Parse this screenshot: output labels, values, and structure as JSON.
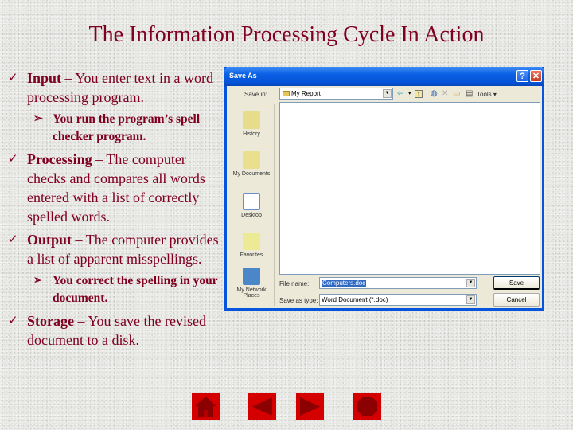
{
  "slide": {
    "title": "The Information Processing Cycle In Action",
    "bullets": [
      {
        "term": "Input",
        "text": " – You enter text in a word processing program.",
        "sub": "You run the program’s spell checker program."
      },
      {
        "term": "Processing",
        "text": " – The computer checks and compares all words entered with a list of correctly spelled words."
      },
      {
        "term": "Output",
        "text": " – The computer provides a list of apparent misspellings.",
        "sub": "You correct the spelling in your document."
      },
      {
        "term": "Storage",
        "text": " – You save the revised document to a disk."
      }
    ],
    "check_glyph": "✓",
    "arrow_glyph": "➢"
  },
  "dialog": {
    "title": "Save As",
    "help_label": "?",
    "close_label": "✕",
    "save_in_label": "Save in:",
    "save_in_value": "My Report",
    "tools_label": "Tools ▾",
    "places": [
      "History",
      "My Documents",
      "Desktop",
      "Favorites",
      "My Network Places"
    ],
    "file_name_label": "File name:",
    "file_name_value": "Computers.doc",
    "save_type_label": "Save as type:",
    "save_type_value": "Word Document (*.doc)",
    "save_button": "Save",
    "cancel_button": "Cancel"
  },
  "nav": {
    "icons": [
      "home-icon",
      "back-icon",
      "forward-icon",
      "end-icon"
    ],
    "color": "#d40000",
    "glyph_color": "#8b0000"
  }
}
